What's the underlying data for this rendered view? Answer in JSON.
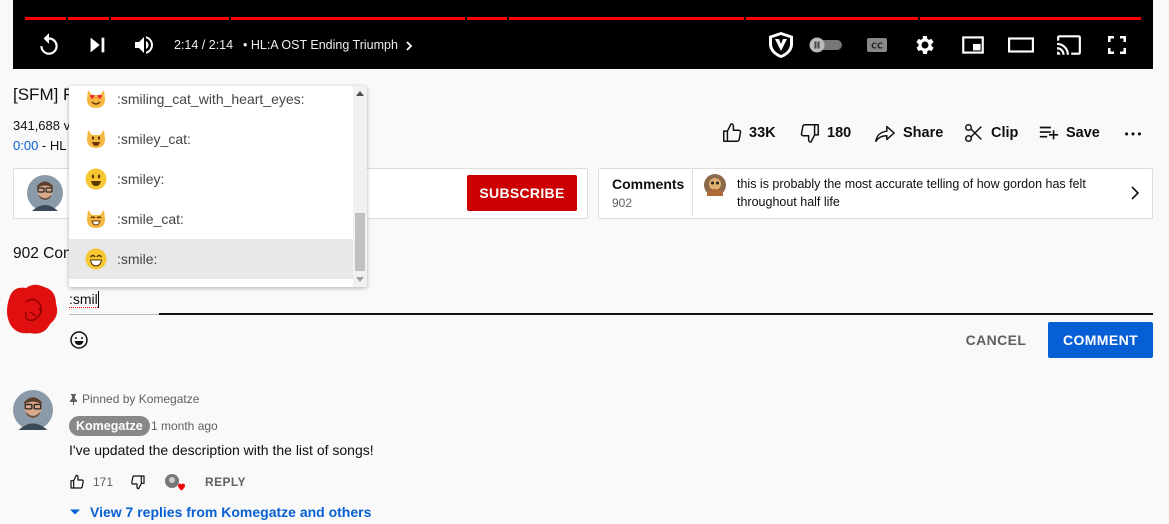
{
  "player": {
    "time": "2:14 / 2:14",
    "chapter": "HL:A OST Ending Triumph",
    "icons": [
      "replay-icon",
      "next-icon",
      "volume-icon",
      "chapter-chevron-icon",
      "shield-extension-icon",
      "autoplay-toggle-icon",
      "captions-icon",
      "settings-icon",
      "miniplayer-icon",
      "theater-icon",
      "cast-icon",
      "fullscreen-icon"
    ]
  },
  "video": {
    "title_visible": "[SFM] F",
    "views_visible": "341,688 v",
    "timestamp": "0:00",
    "timestamp_rest": " - HL"
  },
  "actions": {
    "likes": "33K",
    "dislikes": "180",
    "share": "Share",
    "clip": "Clip",
    "save": "Save"
  },
  "channel": {
    "subscribe_label": "SUBSCRIBE"
  },
  "comments_teaser": {
    "title": "Comments",
    "count": "902",
    "text": "this is probably the most accurate telling of how gordon has felt throughout half life"
  },
  "comments": {
    "count_visible": "902 Con"
  },
  "comment_box": {
    "value": ":smil",
    "cancel_label": "CANCEL",
    "submit_label": "COMMENT"
  },
  "emoji_suggestions": [
    {
      "name": ":smiling_cat_with_heart_eyes:",
      "icon": "cat-heart-eyes-icon",
      "selected": false
    },
    {
      "name": ":smiley_cat:",
      "icon": "smiley-cat-icon",
      "selected": false
    },
    {
      "name": ":smiley:",
      "icon": "smiley-icon",
      "selected": false
    },
    {
      "name": ":smile_cat:",
      "icon": "smile-cat-icon",
      "selected": false
    },
    {
      "name": ":smile:",
      "icon": "smile-icon",
      "selected": true
    }
  ],
  "pinned_comment": {
    "pinned_label": "Pinned by Komegatze",
    "author": "Komegatze",
    "time": "1 month ago",
    "text": "I've updated the description with the list of songs!",
    "likes": "171",
    "reply_label": "REPLY",
    "view_replies": "View 7 replies from Komegatze and others"
  },
  "colors": {
    "brand_red": "#cc0000",
    "progress_red": "#ff0000",
    "link_blue": "#065fd4"
  }
}
